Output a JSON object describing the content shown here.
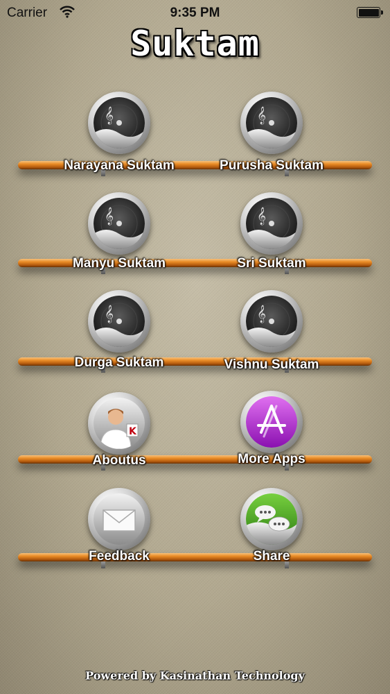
{
  "status_bar": {
    "carrier": "Carrier",
    "time": "9:35 PM",
    "wifi_icon": "wifi-icon",
    "battery_icon": "battery-icon"
  },
  "app": {
    "title": "Suktam"
  },
  "items": [
    {
      "label": "Narayana Suktam",
      "icon": "music-disc-icon"
    },
    {
      "label": "Purusha Suktam",
      "icon": "music-disc-icon"
    },
    {
      "label": "Manyu Suktam",
      "icon": "music-disc-icon"
    },
    {
      "label": "Sri Suktam",
      "icon": "music-disc-icon"
    },
    {
      "label": "Durga Suktam",
      "icon": "music-disc-icon"
    },
    {
      "label": "Vishnu Suktam",
      "icon": "music-disc-icon"
    },
    {
      "label": "Aboutus",
      "icon": "person-icon"
    },
    {
      "label": "More Apps",
      "icon": "app-store-icon"
    },
    {
      "label": "Feedback",
      "icon": "mail-icon"
    },
    {
      "label": "Share",
      "icon": "chat-bubbles-icon"
    }
  ],
  "footer": {
    "text": "Powered by Kasinathan Technology"
  },
  "colors": {
    "shelf": "#ea8d28",
    "more_apps_accent": "#a020c0",
    "share_accent": "#3a9a1a"
  }
}
